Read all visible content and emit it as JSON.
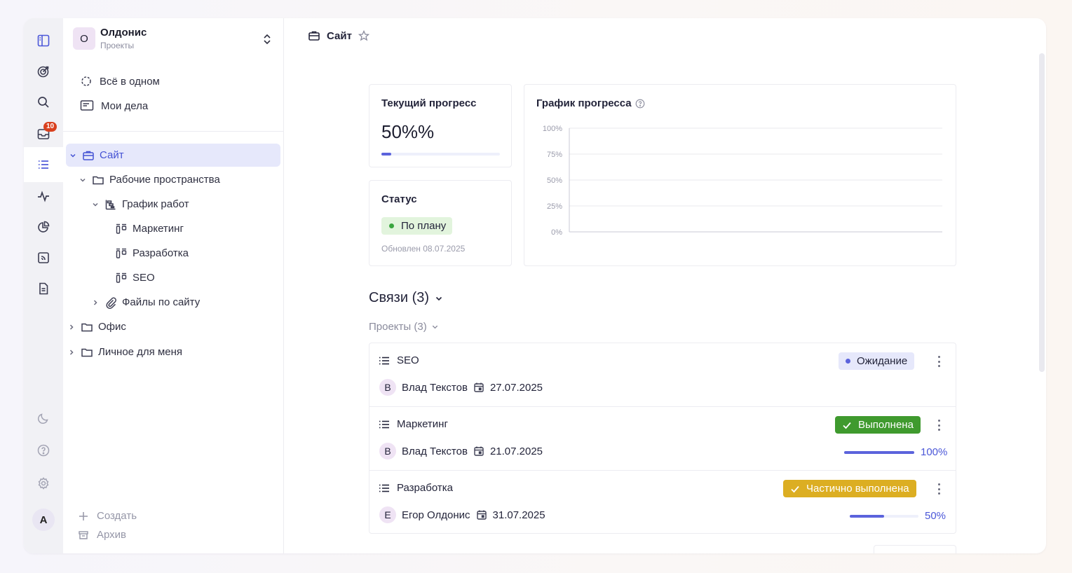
{
  "rail": {
    "items": [
      {
        "icon": "panel-icon"
      },
      {
        "icon": "target-icon"
      },
      {
        "icon": "search-icon"
      },
      {
        "icon": "inbox-icon",
        "badge": "10"
      },
      {
        "icon": "list-icon",
        "active": true
      },
      {
        "icon": "activity-icon"
      },
      {
        "icon": "pie-chart-icon"
      },
      {
        "icon": "feed-icon"
      },
      {
        "icon": "document-icon"
      }
    ],
    "bottom": [
      {
        "icon": "moon-icon"
      },
      {
        "icon": "help-icon"
      },
      {
        "icon": "settings-icon"
      }
    ],
    "avatar": "A"
  },
  "sidebar": {
    "org": {
      "initial": "О",
      "name": "Олдонис",
      "subtitle": "Проекты"
    },
    "top_items": [
      {
        "label": "Всё в одном",
        "icon": "all-in-one-icon"
      },
      {
        "label": "Мои дела",
        "icon": "tasks-icon"
      }
    ],
    "tree": [
      {
        "label": "Сайт",
        "icon": "briefcase-icon",
        "selected": true
      },
      {
        "label": "Рабочие пространства",
        "icon": "folder-icon"
      },
      {
        "label": "График работ",
        "icon": "gantt-icon"
      },
      {
        "label": "Маркетинг",
        "icon": "board-icon"
      },
      {
        "label": "Разработка",
        "icon": "board-icon"
      },
      {
        "label": "SEO",
        "icon": "board-icon"
      },
      {
        "label": "Файлы по сайту",
        "icon": "paperclip-icon"
      },
      {
        "label": "Офис",
        "icon": "folder-icon"
      },
      {
        "label": "Личное для меня",
        "icon": "folder-icon"
      }
    ],
    "create_label": "Создать",
    "archive_label": "Архив"
  },
  "header": {
    "title": "Сайт"
  },
  "progress_card": {
    "title": "Текущий прогресс",
    "value": "50%%",
    "fraction": 0.08
  },
  "status_card": {
    "title": "Статус",
    "status": "По плану",
    "updated": "Обновлен 08.07.2025",
    "status_color": "#3aa53f"
  },
  "chart_card": {
    "title": "График прогресса"
  },
  "chart_data": {
    "type": "line",
    "title": "График прогресса",
    "yticks": [
      "100%",
      "75%",
      "50%",
      "25%",
      "0%"
    ],
    "ylim": [
      0,
      100
    ],
    "series": [],
    "grid": true
  },
  "links": {
    "title": "Связи (3)",
    "projects_label": "Проекты (3)",
    "rows": [
      {
        "name": "SEO",
        "assignee_initial": "В",
        "assignee": "Влад Текстов",
        "date": "27.07.2025",
        "status": "Ожидание",
        "status_bg": "#e6e8fb",
        "status_fg": "#23243a",
        "dot_color": "#5b63dc",
        "progress": null,
        "progress_label": ""
      },
      {
        "name": "Маркетинг",
        "assignee_initial": "В",
        "assignee": "Влад Текстов",
        "date": "21.07.2025",
        "status": "Выполнена",
        "status_bg": "#3f9a2e",
        "status_fg": "#ffffff",
        "progress": 1.0,
        "progress_label": "100%"
      },
      {
        "name": "Разработка",
        "assignee_initial": "Е",
        "assignee": "Егор Олдонис",
        "date": "31.07.2025",
        "status": "Частично выполнена",
        "status_bg": "#dcae22",
        "status_fg": "#ffffff",
        "progress": 0.5,
        "progress_label": "50%"
      }
    ]
  }
}
